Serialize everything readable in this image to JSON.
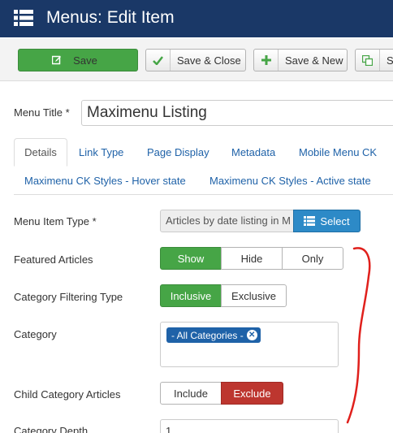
{
  "header": {
    "title": "Menus: Edit Item",
    "icon": "menu-list-icon"
  },
  "toolbar": {
    "save_label": "Save",
    "save_close_label": "Save & Close",
    "save_new_label": "Save & New",
    "copy_label": "S"
  },
  "form": {
    "menu_title_label": "Menu Title *",
    "menu_title_value": "Maximenu Listing"
  },
  "tabs": [
    {
      "label": "Details"
    },
    {
      "label": "Link Type"
    },
    {
      "label": "Page Display"
    },
    {
      "label": "Metadata"
    },
    {
      "label": "Mobile Menu CK"
    },
    {
      "label": "Maximenu CK Styles - Hover state"
    },
    {
      "label": "Maximenu CK Styles - Active state"
    }
  ],
  "active_tab": "Details",
  "fields": {
    "menu_item_type": {
      "label": "Menu Item Type *",
      "value": "Articles by date listing in M",
      "select_label": "Select"
    },
    "featured_articles": {
      "label": "Featured Articles",
      "options": [
        "Show",
        "Hide",
        "Only"
      ],
      "selected": "Show"
    },
    "category_filtering": {
      "label": "Category Filtering Type",
      "options": [
        "Inclusive",
        "Exclusive"
      ],
      "selected": "Inclusive"
    },
    "category": {
      "label": "Category",
      "chip": "- All Categories -"
    },
    "child_category": {
      "label": "Child Category Articles",
      "options": [
        "Include",
        "Exclude"
      ],
      "selected": "Exclude"
    },
    "category_depth": {
      "label": "Category Depth",
      "value": "1"
    }
  },
  "colors": {
    "header_bg": "#1a3867",
    "success": "#46a546",
    "danger": "#bd362f",
    "primary": "#2d8ac7",
    "link": "#1f62a8",
    "annotation": "#e0201c"
  }
}
